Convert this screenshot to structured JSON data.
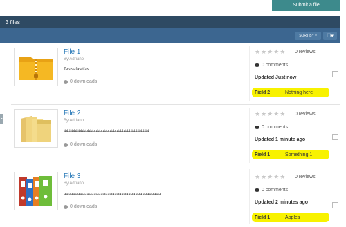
{
  "toolbar": {
    "submit_label": "Submit a file"
  },
  "header": {
    "file_count": "3 files"
  },
  "controls": {
    "sort_label": "SORT BY ▾",
    "view_label": "☐▾"
  },
  "files": [
    {
      "title": "File 1",
      "by": "By Adriano",
      "description": "Testsafasdfas",
      "downloads": "0 downloads",
      "rating_stars": 0,
      "reviews": "0 reviews",
      "comments": "0 comments",
      "updated": "Updated Just now",
      "field_label": "Field 2",
      "field_value": "Nothing here",
      "icon": "zip-folder-icon"
    },
    {
      "title": "File 2",
      "by": "By Adriano",
      "description": "4444444444444444444444444444444444444",
      "downloads": "0 downloads",
      "rating_stars": 0,
      "reviews": "0 reviews",
      "comments": "0 comments",
      "updated": "Updated 1 minute ago",
      "field_label": "Field 1",
      "field_value": "Something 1",
      "icon": "folders-icon"
    },
    {
      "title": "File 3",
      "by": "By Adriano",
      "description": "aaaaaaaaaaaaaaaaaaaaaaaaaaaaaaaaaaaaaaaaaa",
      "downloads": "0 downloads",
      "rating_stars": 0,
      "reviews": "0 reviews",
      "comments": "0 comments",
      "updated": "Updated 2 minutes ago",
      "field_label": "Field 1",
      "field_value": "Apples",
      "icon": "binders-icon"
    }
  ]
}
